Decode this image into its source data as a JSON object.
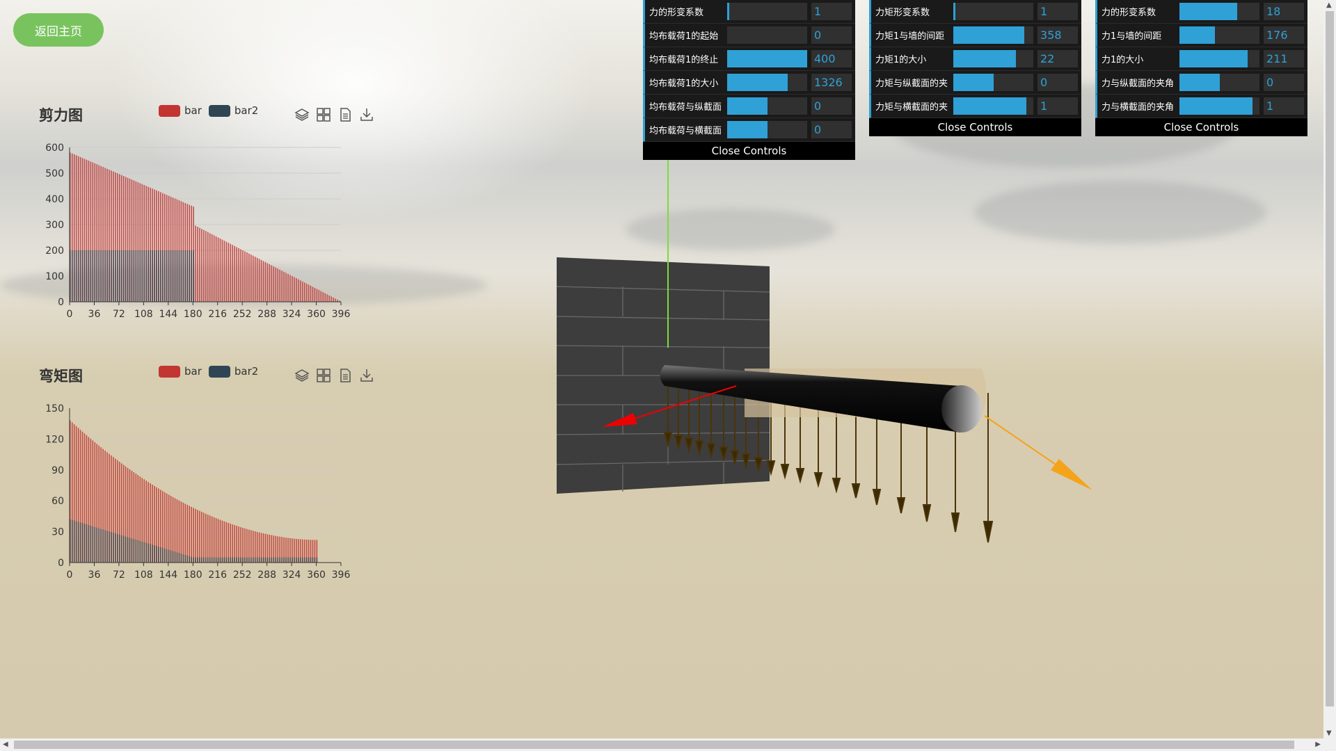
{
  "home_button": "返回主页",
  "charts": [
    {
      "title": "剪力图",
      "legend": [
        "bar",
        "bar2"
      ],
      "chart_data": {
        "type": "bar",
        "title": "剪力图",
        "series": [
          {
            "name": "bar",
            "color": "#c23531",
            "values_desc": "declines from 580 at 0 to 370 at 180, drops to 300, then linear to 0 at 396"
          },
          {
            "name": "bar2",
            "color": "#2f4554",
            "values_desc": "constant 200 from 0 to 180, then 0"
          }
        ],
        "x_ticks": [
          "0",
          "36",
          "72",
          "108",
          "144",
          "180",
          "216",
          "252",
          "288",
          "324",
          "360",
          "396"
        ],
        "y_ticks": [
          "0",
          "100",
          "200",
          "300",
          "400",
          "500",
          "600"
        ],
        "ylim": [
          0,
          600
        ],
        "xlim": [
          0,
          396
        ]
      }
    },
    {
      "title": "弯矩图",
      "legend": [
        "bar",
        "bar2"
      ],
      "chart_data": {
        "type": "bar",
        "title": "弯矩图",
        "series": [
          {
            "name": "bar",
            "color": "#c23531",
            "values_desc": "convex decline from 138 at 0 to about 55 at 180, to about 22 at 360"
          },
          {
            "name": "bar2",
            "color": "#2f4554",
            "values_desc": "linear from 42 at 0 to about 5 at 180, then 5 until 360"
          }
        ],
        "x_ticks": [
          "0",
          "36",
          "72",
          "108",
          "144",
          "180",
          "216",
          "252",
          "288",
          "324",
          "360",
          "396"
        ],
        "y_ticks": [
          "0",
          "30",
          "60",
          "90",
          "120",
          "150"
        ],
        "ylim": [
          0,
          150
        ],
        "xlim": [
          0,
          396
        ]
      }
    }
  ],
  "panels": [
    {
      "rows": [
        {
          "label": "力的形变系数",
          "value": "1",
          "fill": 0.03
        },
        {
          "label": "均布载荷1的起始",
          "value": "0",
          "fill": 0.0
        },
        {
          "label": "均布载荷1的终止",
          "value": "400",
          "fill": 1.0
        },
        {
          "label": "均布载荷1的大小",
          "value": "1326",
          "fill": 0.76
        },
        {
          "label": "均布载荷与纵截面",
          "value": "0",
          "fill": 0.5
        },
        {
          "label": "均布载荷与横截面",
          "value": "0",
          "fill": 0.5
        }
      ],
      "close_label": "Close Controls"
    },
    {
      "rows": [
        {
          "label": "力矩形变系数",
          "value": "1",
          "fill": 0.03
        },
        {
          "label": "力矩1与墙的间距",
          "value": "358",
          "fill": 0.89
        },
        {
          "label": "力矩1的大小",
          "value": "22",
          "fill": 0.78
        },
        {
          "label": "力矩与纵截面的夹",
          "value": "0",
          "fill": 0.5
        },
        {
          "label": "力矩与横截面的夹",
          "value": "1",
          "fill": 0.91
        }
      ],
      "close_label": "Close Controls"
    },
    {
      "rows": [
        {
          "label": "力的形变系数",
          "value": "18",
          "fill": 0.72
        },
        {
          "label": "力1与墙的间距",
          "value": "176",
          "fill": 0.44
        },
        {
          "label": "力1的大小",
          "value": "211",
          "fill": 0.85
        },
        {
          "label": "力与纵截面的夹角",
          "value": "0",
          "fill": 0.5
        },
        {
          "label": "力与横截面的夹角",
          "value": "1",
          "fill": 0.91
        }
      ],
      "close_label": "Close Controls"
    }
  ],
  "toolbox_icons": [
    "stack-icon",
    "grid-icon",
    "document-icon",
    "download-icon"
  ]
}
